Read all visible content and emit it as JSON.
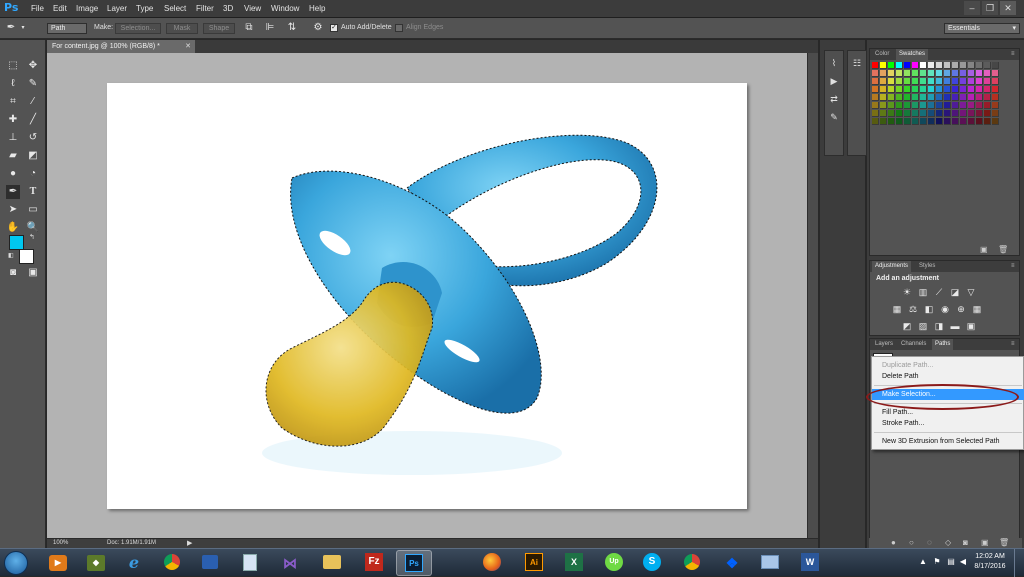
{
  "app": {
    "logo": "Ps",
    "menu": [
      "File",
      "Edit",
      "Image",
      "Layer",
      "Type",
      "Select",
      "Filter",
      "3D",
      "View",
      "Window",
      "Help"
    ],
    "window_controls": [
      "minimize",
      "restore",
      "close"
    ]
  },
  "options_bar": {
    "tool_mode": "Path",
    "make_label": "Make:",
    "selection_btn": "Selection...",
    "mask_btn": "Mask",
    "shape_btn": "Shape",
    "auto_add_delete": "Auto Add/Delete",
    "auto_add_delete_checked": true,
    "align_edges": "Align Edges",
    "align_edges_checked": false,
    "workspace": "Essentials"
  },
  "document": {
    "tab_title": "For content.jpg @ 100% (RGB/8) *",
    "zoom": "100%",
    "doc_size": "Doc: 1.91M/1.91M"
  },
  "tools": [
    "move-icon",
    "marquee-icon",
    "lasso-icon",
    "quick-select-icon",
    "crop-icon",
    "eyedropper-icon",
    "healing-icon",
    "brush-icon",
    "stamp-icon",
    "history-brush-icon",
    "eraser-icon",
    "gradient-icon",
    "blur-icon",
    "dodge-icon",
    "pen-icon",
    "type-icon",
    "path-select-icon",
    "rectangle-icon",
    "hand-icon",
    "zoom-icon"
  ],
  "colors": {
    "foreground": "#00c8f0",
    "background": "#ffffff",
    "pacifier_blue": "#3aa6dc",
    "nipple_yellow": "#e0b820",
    "highlight": "#3399ff",
    "oval": "#8b1a1a"
  },
  "swatches_panel": {
    "tabs": [
      "Color",
      "Swatches"
    ],
    "active_tab": "Swatches"
  },
  "adjustments_panel": {
    "tabs": [
      "Adjustments",
      "Styles"
    ],
    "title": "Add an adjustment"
  },
  "layers_panel": {
    "tabs": [
      "Layers",
      "Channels",
      "Paths"
    ],
    "active_tab": "Paths"
  },
  "context_menu": {
    "items": [
      {
        "label": "Duplicate Path...",
        "disabled": true
      },
      {
        "label": "Delete Path",
        "disabled": false
      },
      {
        "label": "Make Selection...",
        "highlight": true
      },
      {
        "label": "Fill Path...",
        "disabled": false
      },
      {
        "label": "Stroke Path...",
        "disabled": false
      },
      {
        "label": "New 3D Extrusion from Selected Path",
        "disabled": false
      }
    ]
  },
  "taskbar": {
    "apps": [
      "media-player",
      "sim-game",
      "internet-explorer",
      "chrome",
      "book",
      "notepad",
      "visual-studio",
      "file-explorer",
      "filezilla",
      "photoshop",
      "firefox",
      "illustrator",
      "excel",
      "upwork",
      "skype",
      "chrome-alt",
      "dropbox",
      "window",
      "word"
    ],
    "time": "12:02 AM",
    "date": "8/17/2016"
  }
}
